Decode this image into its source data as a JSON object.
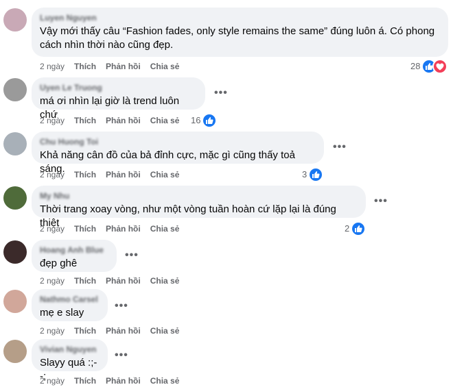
{
  "comments": [
    {
      "author": "Luyen Nguyen",
      "text": "Vậy mới thấy câu “Fashion fades, only style remains the same” đúng luôn á. Có phong cách nhìn thời nào cũng đẹp.",
      "time": "2 ngày",
      "like_label": "Thích",
      "reply_label": "Phản hồi",
      "share_label": "Chia sẻ",
      "reaction_count": "28",
      "reactions": [
        "like-icon",
        "love-icon"
      ],
      "avatar_color": "#c9a9b6"
    },
    {
      "author": "Uyen Le Truong",
      "text": "má ơi nhìn lại giờ là trend luôn chứ",
      "time": "2 ngày",
      "like_label": "Thích",
      "reply_label": "Phản hồi",
      "share_label": "Chia sẻ",
      "reaction_count": "16",
      "reactions": [
        "like-icon"
      ],
      "avatar_color": "#9a9a9a"
    },
    {
      "author": "Chu Huong Toi",
      "text": "Khả năng cân đồ của bả đỉnh cực, mặc gì cũng thấy toả sáng.",
      "time": "2 ngày",
      "like_label": "Thích",
      "reply_label": "Phản hồi",
      "share_label": "Chia sẻ",
      "reaction_count": "3",
      "reactions": [
        "like-icon"
      ],
      "avatar_color": "#a8b0b8"
    },
    {
      "author": "My Nhu",
      "text": "Thời trang xoay vòng, như một vòng tuần hoàn cứ lặp lại là đúng thiệt",
      "time": "2 ngày",
      "like_label": "Thích",
      "reply_label": "Phản hồi",
      "share_label": "Chia sẻ",
      "reaction_count": "2",
      "reactions": [
        "like-icon"
      ],
      "avatar_color": "#4f6b3a"
    },
    {
      "author": "Hoang Anh Blue",
      "text": "đẹp ghê",
      "time": "2 ngày",
      "like_label": "Thích",
      "reply_label": "Phản hồi",
      "share_label": "Chia sẻ",
      "reaction_count": "",
      "reactions": [],
      "avatar_color": "#3b2a2a"
    },
    {
      "author": "Nathmo Carsel",
      "text": "mẹ e slay",
      "time": "2 ngày",
      "like_label": "Thích",
      "reply_label": "Phản hồi",
      "share_label": "Chia sẻ",
      "reaction_count": "",
      "reactions": [],
      "avatar_color": "#d1a79a"
    },
    {
      "author": "Vivian Nguyen",
      "text": "Slayy quá :;--;",
      "time": "2 ngày",
      "like_label": "Thích",
      "reply_label": "Phản hồi",
      "share_label": "Chia sẻ",
      "reaction_count": "",
      "reactions": [],
      "avatar_color": "#b59e88"
    }
  ],
  "more_label": "•••"
}
